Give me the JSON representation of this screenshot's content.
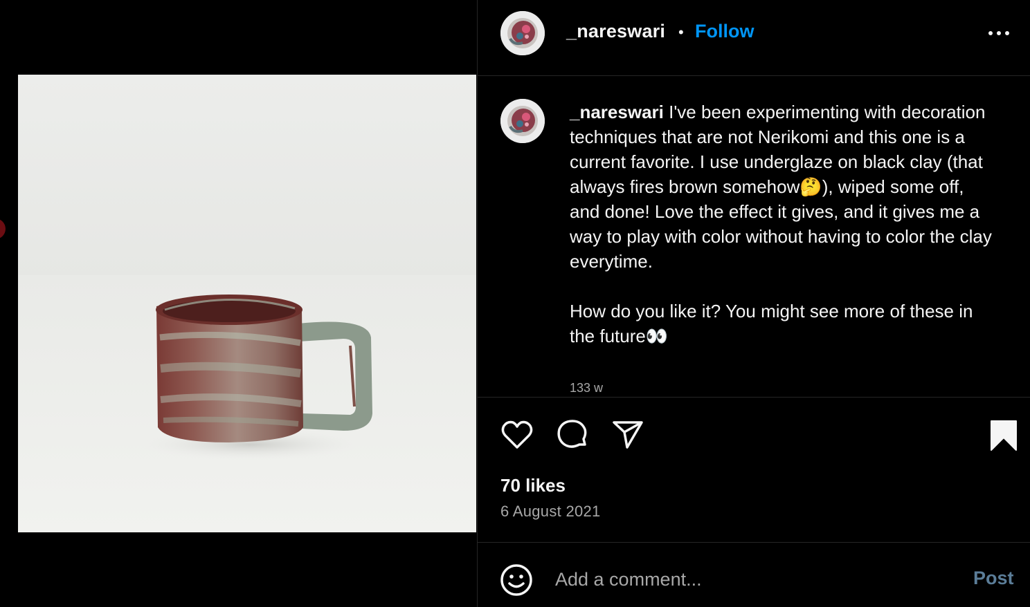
{
  "post": {
    "username": "_nareswari",
    "separator": "•",
    "follow_label": "Follow",
    "more_icon": "more-horizontal-icon"
  },
  "caption": {
    "username": "_nareswari",
    "text": "I've been experimenting with decoration techniques that are not Nerikomi and this one is a current favorite. I use underglaze on black clay (that always fires brown somehow🤔), wiped some off, and done! Love the effect it gives, and it gives me a way to play with color without having to color the clay everytime.\n\nHow do you like it? You might see more of these in the future👀",
    "time": "133 w"
  },
  "actions": {
    "like_icon": "heart-icon",
    "comment_icon": "comment-icon",
    "share_icon": "share-icon",
    "save_icon": "bookmark-icon"
  },
  "stats": {
    "likes": "70 likes",
    "date": "6 August 2021"
  },
  "comment_box": {
    "emoji_icon": "emoji-icon",
    "placeholder": "Add a comment...",
    "post_label": "Post"
  },
  "colors": {
    "background": "#000000",
    "accent": "#0095f6",
    "secondary_text": "#a8a8a8",
    "post_disabled": "#5b7d98"
  }
}
